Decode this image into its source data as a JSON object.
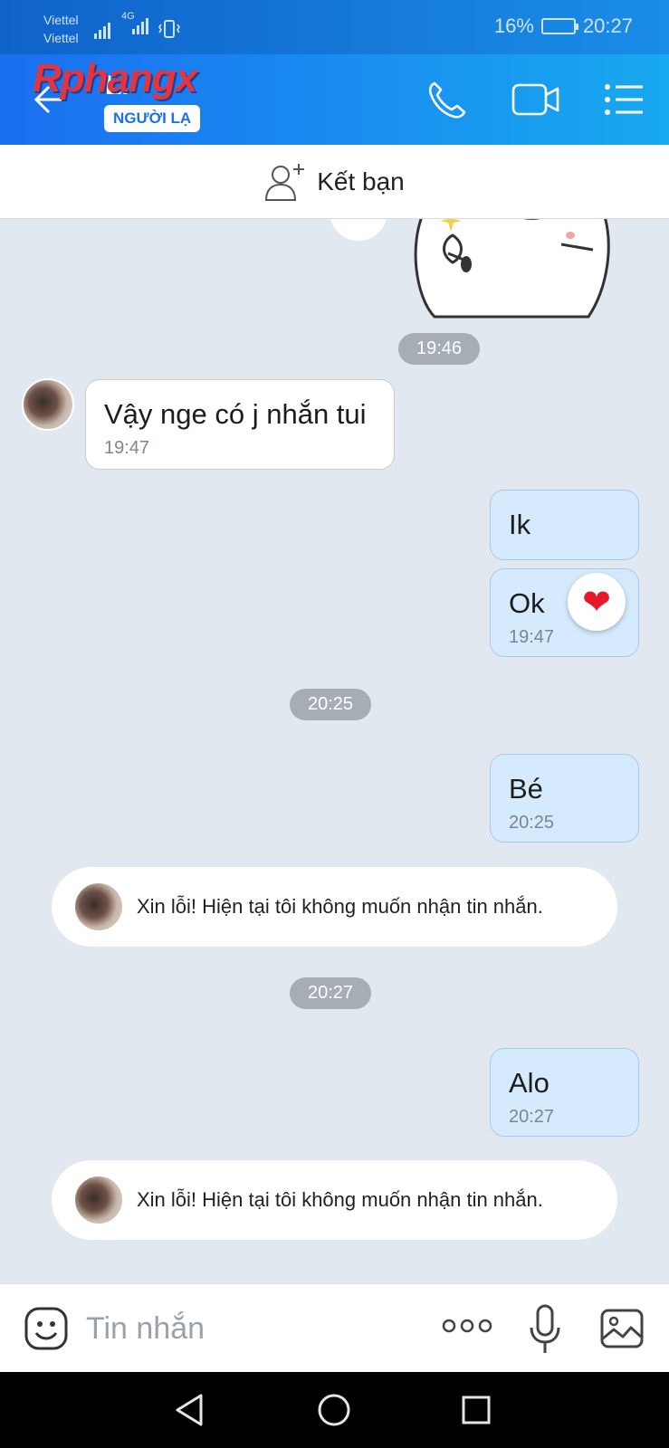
{
  "status": {
    "carrier1": "Viettel",
    "carrier2": "Viettel",
    "network": "4G",
    "battery": "16%",
    "time": "20:27"
  },
  "header": {
    "contact_name": "Li",
    "watermark": "Rphangx",
    "badge": "NGƯỜI LẠ",
    "icons": [
      "back-arrow-icon",
      "phone-icon",
      "video-call-icon",
      "menu-list-icon"
    ]
  },
  "add_friend": {
    "label": "Kết bạn",
    "icon": "add-user-icon"
  },
  "chat": {
    "time_1946": "19:46",
    "incoming_1": {
      "text": "Vậy nge có j nhắn tui",
      "time": "19:47"
    },
    "outgoing_1": {
      "text": "Ik"
    },
    "outgoing_2": {
      "text": "Ok",
      "time": "19:47",
      "reaction": "❤"
    },
    "time_2025": "20:25",
    "outgoing_3": {
      "text": "Bé",
      "time": "20:25"
    },
    "auto_reply_1": "Xin lỗi! Hiện tại tôi không muốn nhận tin nhắn.",
    "time_2027": "20:27",
    "outgoing_4": {
      "text": "Alo",
      "time": "20:27"
    },
    "auto_reply_2": "Xin lỗi! Hiện tại tôi không muốn nhận tin nhắn."
  },
  "input": {
    "placeholder": "Tin nhắn",
    "icons": [
      "sticker-icon",
      "more-icon",
      "microphone-icon",
      "image-icon"
    ]
  },
  "nav": {
    "icons": [
      "back-nav-icon",
      "home-nav-icon",
      "recents-nav-icon"
    ]
  },
  "colors": {
    "header_start": "#1a6ff0",
    "header_end": "#18a9ef",
    "outgoing_bubble": "#d5ebfd",
    "chat_bg": "#e2e8f0",
    "time_pill": "#a7adb5"
  }
}
